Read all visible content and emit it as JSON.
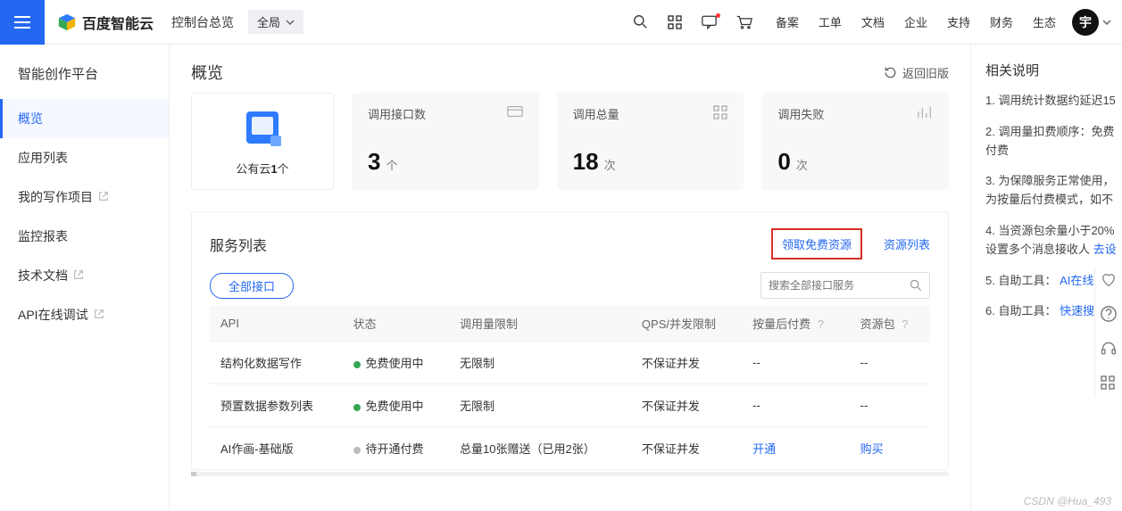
{
  "header": {
    "brand": "百度智能云",
    "crumb": "控制台总览",
    "scope": "全局",
    "text_links": [
      "备案",
      "工单",
      "文档",
      "企业",
      "支持",
      "财务",
      "生态"
    ],
    "avatar_letter": "宇",
    "old_version_label": "返回旧版"
  },
  "sidenav": {
    "heading": "智能创作平台",
    "items": [
      {
        "label": "概览",
        "active": true,
        "external": false
      },
      {
        "label": "应用列表",
        "active": false,
        "external": false
      },
      {
        "label": "我的写作项目",
        "active": false,
        "external": true
      },
      {
        "label": "监控报表",
        "active": false,
        "external": false
      },
      {
        "label": "技术文档",
        "active": false,
        "external": true
      },
      {
        "label": "API在线调试",
        "active": false,
        "external": true
      }
    ]
  },
  "page": {
    "title": "概览",
    "cloud_label_prefix": "公有云",
    "cloud_count": "1",
    "cloud_label_suffix": "个",
    "metrics": [
      {
        "title": "调用接口数",
        "value": "3",
        "unit": "个"
      },
      {
        "title": "调用总量",
        "value": "18",
        "unit": "次"
      },
      {
        "title": "调用失败",
        "value": "0",
        "unit": "次"
      }
    ]
  },
  "panel": {
    "title": "服务列表",
    "free_label": "领取免费资源",
    "list_label": "资源列表",
    "filter_all": "全部接口",
    "search_placeholder": "搜索全部接口服务",
    "columns": [
      "API",
      "状态",
      "调用量限制",
      "QPS/并发限制",
      "按量后付费",
      "资源包"
    ],
    "rows": [
      {
        "api": "结构化数据写作",
        "status": "免费使用中",
        "status_color": "green",
        "limit": "无限制",
        "qps": "不保证并发",
        "postpay": "--",
        "pack": "--"
      },
      {
        "api": "预置数据参数列表",
        "status": "免费使用中",
        "status_color": "green",
        "limit": "无限制",
        "qps": "不保证并发",
        "postpay": "--",
        "pack": "--"
      },
      {
        "api": "AI作画-基础版",
        "status": "待开通付费",
        "status_color": "gray",
        "limit": "总量10张赠送（已用2张）",
        "qps": "不保证并发",
        "postpay": "开通",
        "pack": "购买",
        "postpay_link": true,
        "pack_link": true
      }
    ]
  },
  "rightcol": {
    "title": "相关说明",
    "items": [
      {
        "text": "调用统计数据约延迟15"
      },
      {
        "text": "调用量扣费顺序：免费付费",
        "two_line": true,
        "line2": "付费",
        "line1": "调用量扣费顺序：免费"
      },
      {
        "text": "为保障服务正常使用，为按量后付费模式，如不"
      },
      {
        "text": "当资源包余量小于20%设置多个消息接收人",
        "link": "去设"
      },
      {
        "text": "自助工具：",
        "link": "AI在线错误"
      },
      {
        "text": "自助工具：",
        "link": "快速搜索全"
      }
    ]
  },
  "watermark": "CSDN @Hua_493"
}
